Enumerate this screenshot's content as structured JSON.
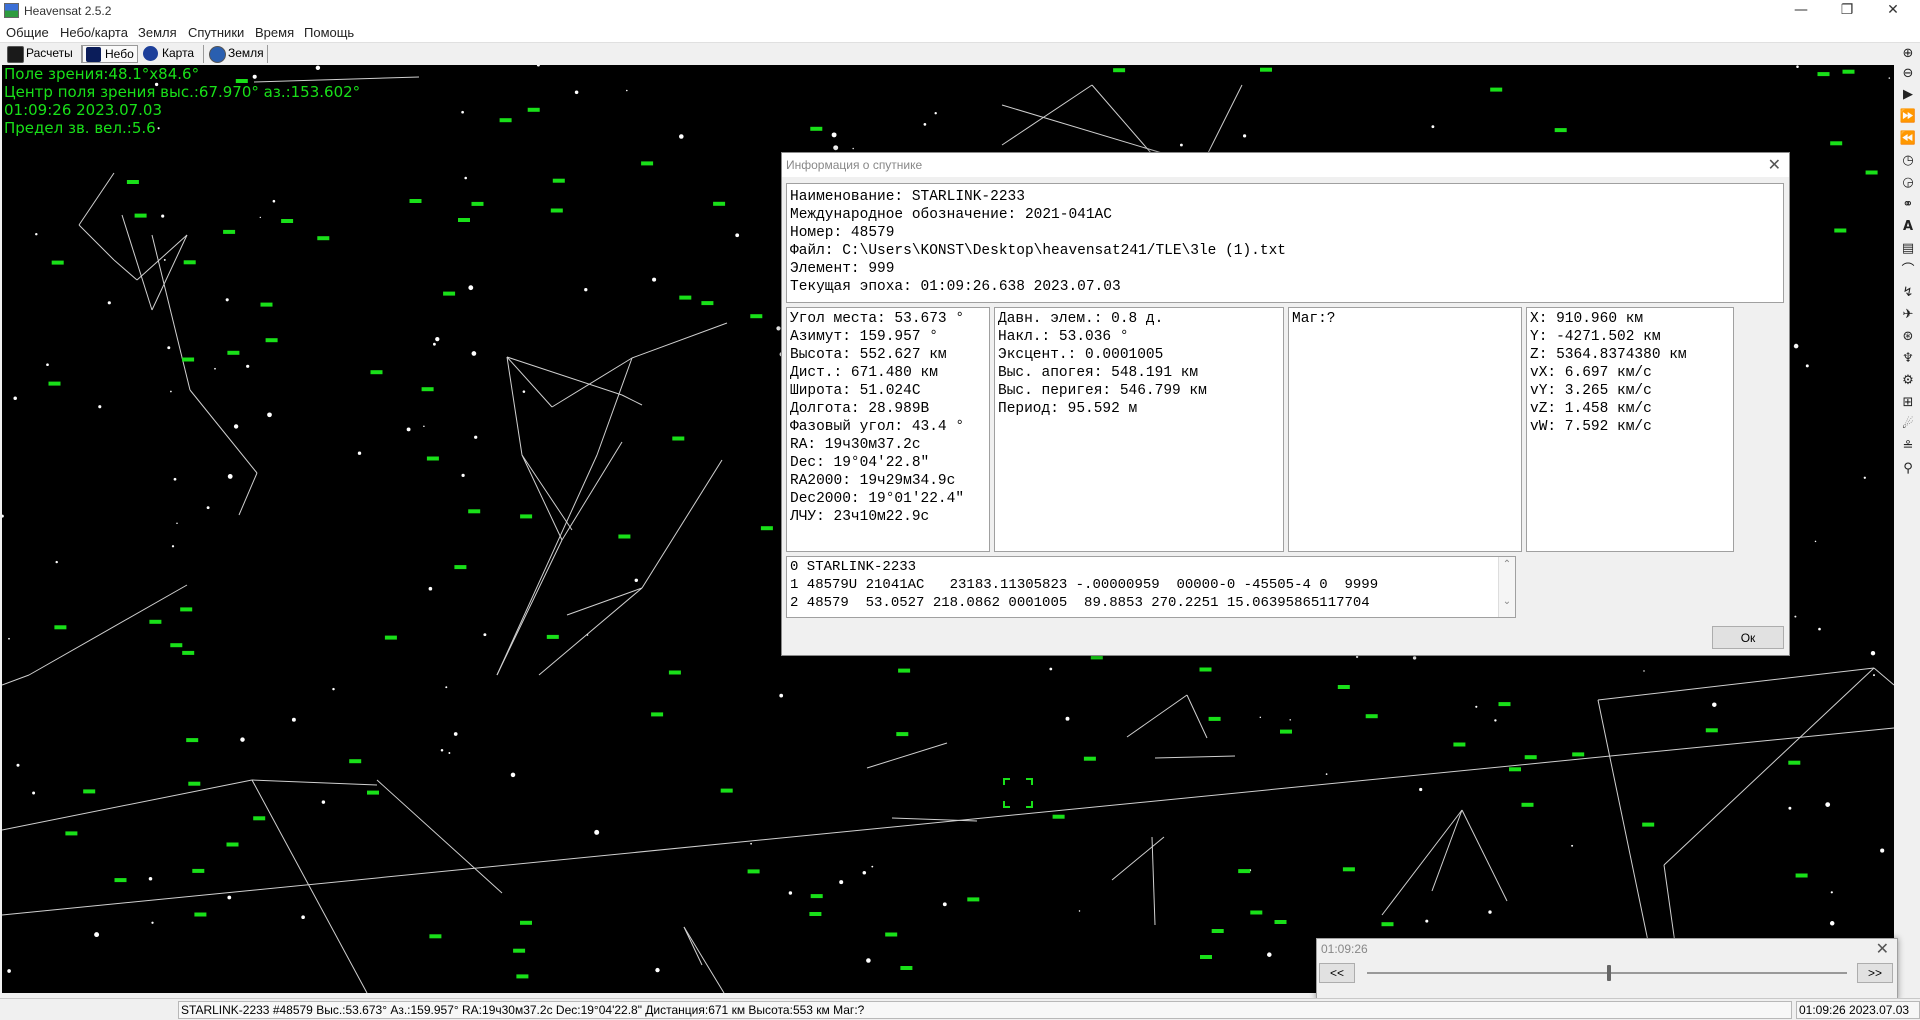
{
  "window": {
    "title": "Heavensat 2.5.2",
    "minimize": "—",
    "restore": "❐",
    "close": "✕"
  },
  "menu": [
    "Общие",
    "Небо/карта",
    "Земля",
    "Спутники",
    "Время",
    "Помощь"
  ],
  "tabs": [
    {
      "label": "Расчеты",
      "icon": "terminal-icon"
    },
    {
      "label": "Небо",
      "icon": "sky-icon"
    },
    {
      "label": "Карта",
      "icon": "globe-icon"
    },
    {
      "label": "Земля",
      "icon": "earth-icon"
    }
  ],
  "sky_info": {
    "field_of_view": "Поле зрения:48.1°x84.6°",
    "center": "Центр поля зрения выс.:67.970° аз.:153.602°",
    "time": "01:09:26 2023.07.03",
    "mag_limit": "Предел зв. вел.:5.6"
  },
  "dialog": {
    "title": "Информация о спутнике",
    "close": "✕",
    "header": [
      "Наименование: STARLINK-2233",
      "Международное обозначение: 2021-041AC",
      "Номер: 48579",
      "Файл: C:\\Users\\KONST\\Desktop\\heavensat241/TLE\\3le (1).txt",
      "Элемент: 999",
      "Текущая эпоха: 01:09:26.638 2023.07.03"
    ],
    "position": [
      "Угол места: 53.673 °",
      "Азимут: 159.957 °",
      "Высота: 552.627 км",
      "Дист.: 671.480 км",
      "Широта: 51.024С",
      "Долгота: 28.989В",
      "Фазовый угол: 43.4 °",
      "RA: 19ч30м37.2с",
      "Dec: 19°04'22.8\"",
      "RA2000: 19ч29м34.9с",
      "Dec2000: 19°01'22.4\"",
      "ЛЧУ: 23ч10м22.9с"
    ],
    "orbit": [
      "Давн. элем.: 0.8 д.",
      "Накл.: 53.036 °",
      "Эксцент.: 0.0001005",
      "Выс. апогея: 548.191 км",
      "Выс. перигея: 546.799 км",
      "Период: 95.592 м"
    ],
    "magnitude": [
      "Маг:?"
    ],
    "vectors": [
      "X: 910.960 км",
      "Y: -4271.502 км",
      "Z: 5364.8374380 км",
      "vX: 6.697 км/с",
      "vY: 3.265 км/с",
      "vZ: 1.458 км/с",
      "vW: 7.592 км/с"
    ],
    "tle": [
      "0 STARLINK-2233",
      "1 48579U 21041AC   23183.11305823 -.00000959  00000-0 -45505-4 0  9999",
      "2 48579  53.0527 218.0862 0001005  89.8853 270.2251 15.06395865117704"
    ],
    "ok": "Ок"
  },
  "time_window": {
    "title": "01:09:26",
    "back": "<<",
    "forward": ">>",
    "close": "✕"
  },
  "status": {
    "left": "STARLINK-2233 #48579  Выс.:53.673°  Аз.:159.957° RA:19ч30м37.2с Dec:19°04'22.8\" Дистанция:671 км  Высота:553 км  Маг:?",
    "right": "01:09:26 2023.07.03"
  },
  "toolbar_icons": [
    "zoom-in-icon",
    "zoom-out-icon",
    "play-icon",
    "fast-forward-icon",
    "rewind-icon",
    "clock-icon",
    "clock-alt-icon",
    "binoculars-icon",
    "text-label-icon",
    "printer-icon",
    "horizon-icon",
    "satellite-pass-icon",
    "satellite-icon",
    "orbit-icon",
    "antenna-icon",
    "settings-icon",
    "grid-icon",
    "comet-icon",
    "dish-icon",
    "telescope-icon"
  ],
  "colors": {
    "sky": "#000000",
    "satellite": "#19e019",
    "info_text": "#19e019",
    "lines": "#d0d0d0"
  }
}
